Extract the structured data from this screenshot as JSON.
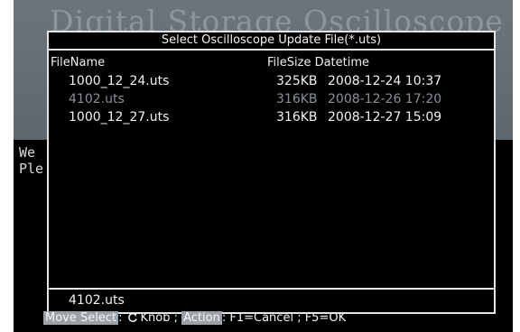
{
  "banner": {
    "title": "Digital Storage Oscilloscope"
  },
  "background_text": {
    "line1": "We",
    "line2": "Ple"
  },
  "dialog": {
    "title": "Select Oscilloscope Update File(*.uts)",
    "columns": {
      "filename": "FileName",
      "filesize_datetime": "FileSize Datetime"
    },
    "files": [
      {
        "name": "1000_12_24.uts",
        "size": "325KB",
        "datetime": "2008-12-24 10:37",
        "selected": false
      },
      {
        "name": "4102.uts",
        "size": "316KB",
        "datetime": "2008-12-26 17:20",
        "selected": true
      },
      {
        "name": "1000_12_27.uts",
        "size": "316KB",
        "datetime": "2008-12-27 15:09",
        "selected": false
      }
    ],
    "selected_file": "4102.uts"
  },
  "footer": {
    "move_select": "Move Select",
    "colon1": ":",
    "knob": "Knob ;",
    "action": "Action",
    "colon2": ":",
    "commands": "F1=Cancel ; F5=OK",
    "knob_icon": "rotate-knob-icon"
  },
  "colors": {
    "banner": "#6d757c",
    "selected_row": "#8a9098",
    "highlight": "#9aa2a8"
  }
}
